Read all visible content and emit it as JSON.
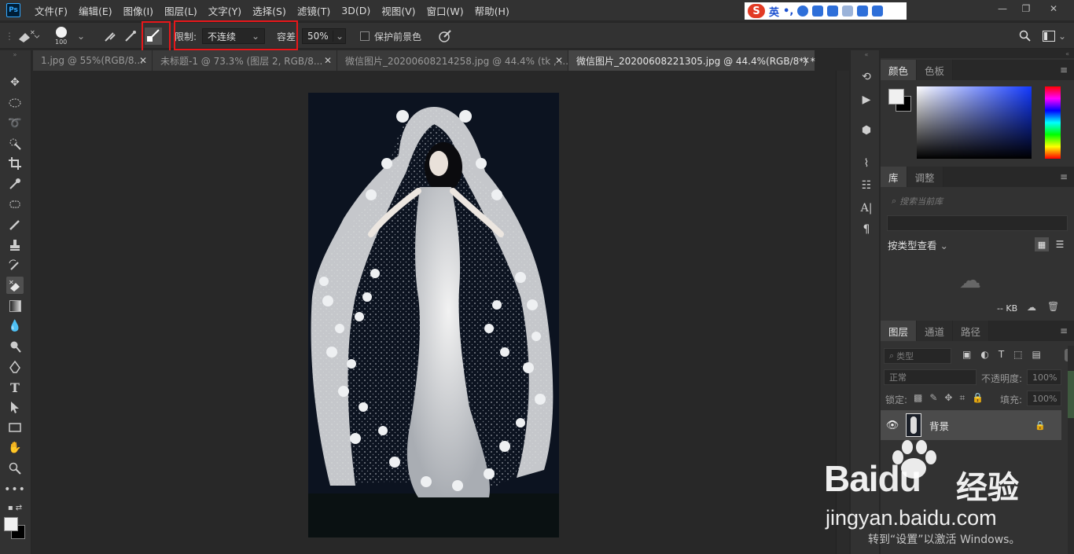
{
  "app": {
    "logo": "Ps"
  },
  "menu": [
    "文件(F)",
    "编辑(E)",
    "图像(I)",
    "图层(L)",
    "文字(Y)",
    "选择(S)",
    "滤镜(T)",
    "3D(D)",
    "视图(V)",
    "窗口(W)",
    "帮助(H)"
  ],
  "ime": {
    "logo": "S",
    "mode": "英",
    "punct": "•,"
  },
  "options": {
    "brush_size": "100",
    "limit_label": "限制:",
    "limit_value": "不连续",
    "tolerance_label": "容差",
    "tolerance_value": "50%",
    "protect_fg_label": "保护前景色"
  },
  "tabs": [
    {
      "label": "1.jpg @ 55%(RGB/8..."
    },
    {
      "label": "未标题-1 @ 73.3% (图层 2, RGB/8..."
    },
    {
      "label": "微信图片_20200608214258.jpg @ 44.4% (tk , ..."
    },
    {
      "label": "微信图片_20200608221305.jpg @ 44.4%(RGB/8*) *"
    }
  ],
  "panels": {
    "color_tabs": [
      "颜色",
      "色板"
    ],
    "library_tabs": [
      "库",
      "调整"
    ],
    "library_search_placeholder": "搜索当前库",
    "view_by_type": "按类型查看",
    "library_size": "-- KB",
    "layer_tabs": [
      "图层",
      "通道",
      "路径"
    ],
    "layer_filter": "类型",
    "blend_mode": "正常",
    "opacity_label": "不透明度:",
    "opacity_value": "100%",
    "lock_label": "锁定:",
    "fill_label": "填充:",
    "fill_value": "100%",
    "layer_name": "背景"
  },
  "watermark": {
    "brand": "Bai",
    "brand2": "du",
    "cn": "经验",
    "url": "jingyan.baidu.com"
  },
  "activation": "转到“设置”以激活 Windows。",
  "colors": {
    "accent_red": "#e8171a",
    "ps_blue": "#31a8ff",
    "panel_bg": "#323232",
    "canvas_bg": "#282828"
  }
}
